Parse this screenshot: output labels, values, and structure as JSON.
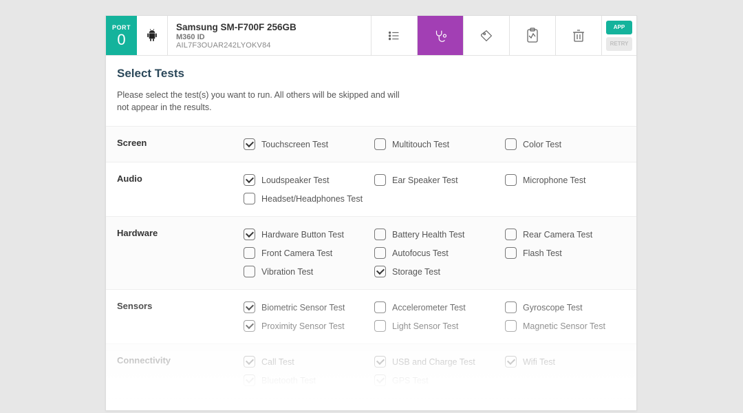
{
  "port": {
    "label": "PORT",
    "number": "0"
  },
  "device": {
    "title": "Samsung SM-F700F 256GB",
    "sub": "M360 ID",
    "serial": "AIL7F3OUAR242LYOKV84"
  },
  "side": {
    "app": "APP",
    "retry": "RETRY"
  },
  "header": {
    "title": "Select Tests",
    "desc": "Please select the test(s) you want to run. All others will be skipped and will not appear in the results."
  },
  "groups": [
    {
      "label": "Screen",
      "items": [
        {
          "label": "Touchscreen Test",
          "checked": true
        },
        {
          "label": "Multitouch Test",
          "checked": false
        },
        {
          "label": "Color Test",
          "checked": false
        }
      ]
    },
    {
      "label": "Audio",
      "items": [
        {
          "label": "Loudspeaker Test",
          "checked": true
        },
        {
          "label": "Ear Speaker Test",
          "checked": false
        },
        {
          "label": "Microphone Test",
          "checked": false
        },
        {
          "label": "Headset/Headphones Test",
          "checked": false
        }
      ]
    },
    {
      "label": "Hardware",
      "items": [
        {
          "label": "Hardware Button Test",
          "checked": true
        },
        {
          "label": "Battery Health Test",
          "checked": false
        },
        {
          "label": "Rear Camera Test",
          "checked": false
        },
        {
          "label": "Front Camera Test",
          "checked": false
        },
        {
          "label": "Autofocus Test",
          "checked": false
        },
        {
          "label": "Flash Test",
          "checked": false
        },
        {
          "label": "Vibration Test",
          "checked": false
        },
        {
          "label": "Storage Test",
          "checked": true
        }
      ]
    },
    {
      "label": "Sensors",
      "items": [
        {
          "label": "Biometric Sensor Test",
          "checked": true
        },
        {
          "label": "Accelerometer Test",
          "checked": false
        },
        {
          "label": "Gyroscope Test",
          "checked": false
        },
        {
          "label": "Proximity Sensor Test",
          "checked": true
        },
        {
          "label": "Light Sensor Test",
          "checked": false
        },
        {
          "label": "Magnetic Sensor Test",
          "checked": false
        }
      ]
    },
    {
      "label": "Connectivity",
      "items": [
        {
          "label": "Call Test",
          "checked": true
        },
        {
          "label": "USB and Charge Test",
          "checked": true
        },
        {
          "label": "Wifi Test",
          "checked": true
        },
        {
          "label": "Bluetooth Test",
          "checked": true
        },
        {
          "label": "GPS Test",
          "checked": true
        }
      ]
    }
  ]
}
